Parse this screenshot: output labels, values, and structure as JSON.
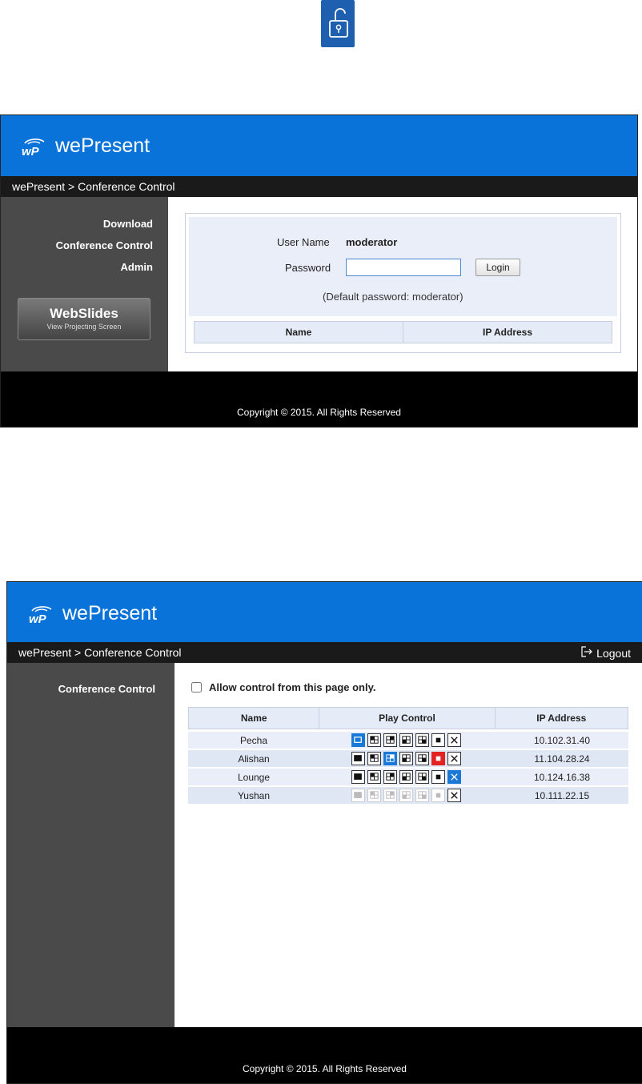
{
  "lock_icon": {
    "icon": "unlocked-padlock-icon",
    "color": "#1f5fb0"
  },
  "login_screen": {
    "brand": "wePresent",
    "breadcrumb": "wePresent > Conference Control",
    "nav": [
      "Download",
      "Conference Control",
      "Admin"
    ],
    "webslides": {
      "title": "WebSlides",
      "subtitle": "View Projecting Screen"
    },
    "username_label": "User Name",
    "username_value": "moderator",
    "password_label": "Password",
    "password_value": "",
    "login_button": "Login",
    "hint": "(Default password: moderator)",
    "table_headers": [
      "Name",
      "IP Address"
    ],
    "footer": "Copyright © 2015. All Rights Reserved"
  },
  "control_screen": {
    "brand": "wePresent",
    "breadcrumb": "wePresent > Conference Control",
    "logout": "Logout",
    "nav": [
      "Conference Control"
    ],
    "allow_checkbox": {
      "label": "Allow control from this page only.",
      "checked": false
    },
    "table_headers": [
      "Name",
      "Play Control",
      "IP Address"
    ],
    "play_control_icons": [
      "full-screen-icon",
      "split-quad-top-left-icon",
      "split-quad-top-right-icon",
      "split-quad-bottom-left-icon",
      "split-quad-bottom-right-icon",
      "stop-icon",
      "disconnect-icon"
    ],
    "rows": [
      {
        "name": "Pecha",
        "ip": "10.102.31.40",
        "states": [
          "active",
          "normal",
          "normal",
          "normal",
          "normal",
          "normal",
          "normal"
        ]
      },
      {
        "name": "Alishan",
        "ip": "11.104.28.24",
        "states": [
          "normal",
          "normal",
          "active",
          "normal",
          "normal",
          "alert",
          "normal"
        ]
      },
      {
        "name": "Lounge",
        "ip": "10.124.16.38",
        "states": [
          "normal",
          "normal",
          "normal",
          "normal",
          "normal",
          "normal",
          "active"
        ]
      },
      {
        "name": "Yushan",
        "ip": "10.111.22.15",
        "states": [
          "disabled",
          "disabled",
          "disabled",
          "disabled",
          "disabled",
          "disabled",
          "normal"
        ]
      }
    ],
    "footer": "Copyright © 2015. All Rights Reserved"
  },
  "colors": {
    "header_blue": "#0a73d9",
    "active_blue": "#1a78d6",
    "alert_red": "#e32222",
    "row_even": "#e9eef8",
    "row_odd": "#dfe6f4"
  }
}
